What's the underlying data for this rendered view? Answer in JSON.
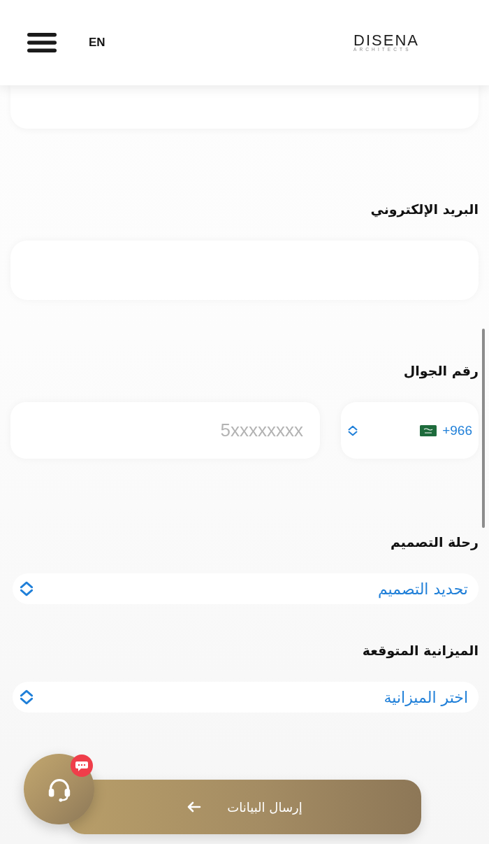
{
  "header": {
    "language_button": "EN",
    "logo": {
      "wordmark": "DISENA",
      "tagline": "ARCHITECTS"
    }
  },
  "form": {
    "fields": [
      {
        "kind": "input"
      },
      {
        "kind": "input",
        "label": "البريد الإلكتروني"
      },
      {
        "kind": "phone",
        "label": "رقم الجوال",
        "country_code": "+966",
        "placeholder": "5xxxxxxxx"
      },
      {
        "kind": "select",
        "label": "رحلة التصميم",
        "value": "تحديد التصميم"
      },
      {
        "kind": "select",
        "label": "الميزانية المتوقعة",
        "value": "اختر الميزانية"
      }
    ]
  },
  "submit_button": {
    "label": "إرسال البيانات"
  },
  "support_button": {
    "has_unread": true
  }
}
